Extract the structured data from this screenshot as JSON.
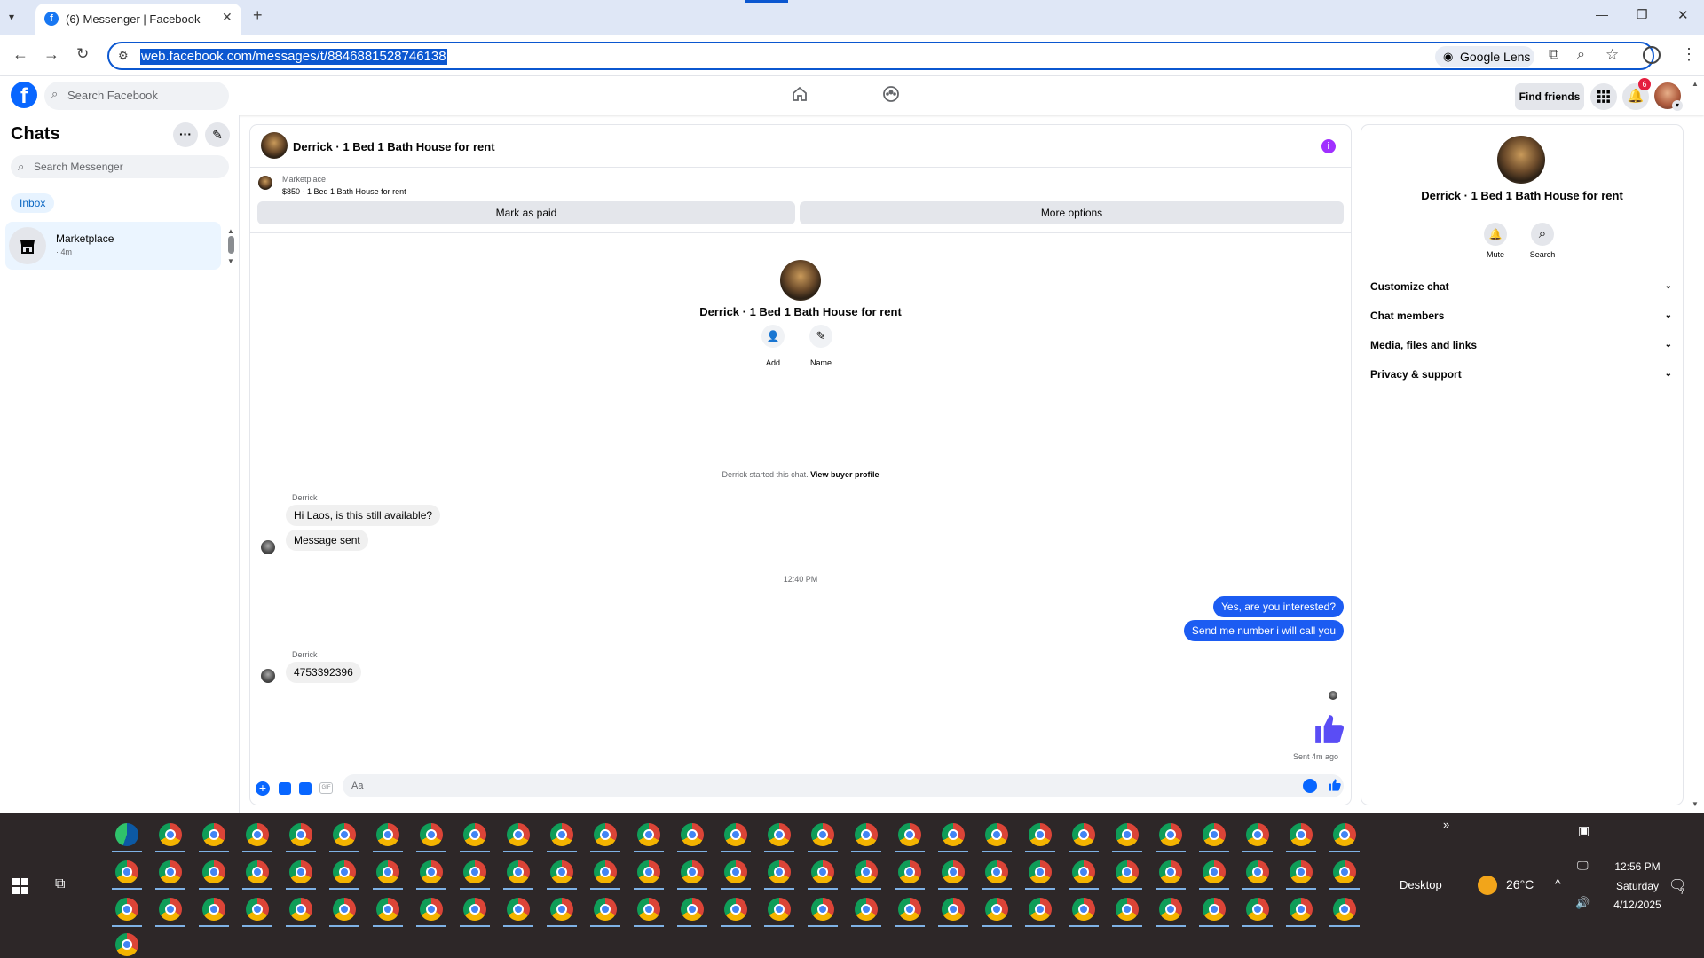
{
  "browser": {
    "tab_title": "(6) Messenger | Facebook",
    "url": "web.facebook.com/messages/t/8846881528746138",
    "lens_label": "Google Lens"
  },
  "fb_header": {
    "search_placeholder": "Search Facebook",
    "find_friends": "Find friends",
    "notification_count": "6"
  },
  "sidebar": {
    "title": "Chats",
    "search_placeholder": "Search Messenger",
    "inbox_tab": "Inbox",
    "chats": [
      {
        "name": "Marketplace",
        "time": "· 4m"
      }
    ]
  },
  "conversation": {
    "title": "Derrick · 1 Bed 1 Bath House for rent",
    "listing": {
      "source": "Marketplace",
      "summary": "$850 - 1 Bed 1 Bath House for rent"
    },
    "actions": {
      "mark_paid": "Mark as paid",
      "more_options": "More options"
    },
    "intro": {
      "name": "Derrick · 1 Bed 1 Bath House for rent",
      "add_label": "Add",
      "name_label": "Name"
    },
    "started_text": "Derrick started this chat.",
    "view_buyer": "View buyer profile",
    "messages": [
      {
        "sender": "Derrick",
        "text": "Hi Laos, is this still available?"
      },
      {
        "text": "Message sent"
      },
      {
        "divider": "12:40 PM"
      },
      {
        "out": "Yes, are you interested?"
      },
      {
        "out": "Send me number i will call you"
      },
      {
        "sender": "Derrick",
        "text": "4753392396"
      }
    ],
    "sent_status": "Sent 4m ago",
    "composer_placeholder": "Aa"
  },
  "details": {
    "name": "Derrick · 1 Bed 1 Bath House for rent",
    "mute": "Mute",
    "search": "Search",
    "sections": [
      "Customize chat",
      "Chat members",
      "Media, files and links",
      "Privacy & support"
    ]
  },
  "taskbar": {
    "desktop_label": "Desktop",
    "temperature": "26°C",
    "time": "12:56 PM",
    "day": "Saturday",
    "date": "4/12/2025",
    "notification_count": "7"
  },
  "colors": {
    "accent": "#0866ff",
    "outgoing_bubble": "#1c5cf2",
    "info_purple": "#a030ff",
    "like_blue": "#5a4df5"
  }
}
